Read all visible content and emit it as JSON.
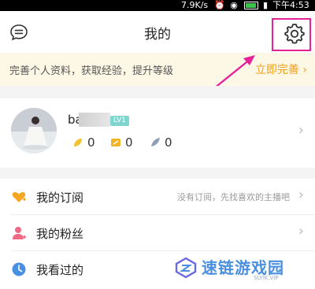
{
  "status_bar": {
    "speed": "7.9K/s",
    "time": "下午4:53"
  },
  "header": {
    "title": "我的",
    "message_icon": "message-icon",
    "settings_icon": "gear-icon"
  },
  "banner": {
    "text": "完善个人资料，获取经验，提升等级",
    "action": "立即完善",
    "action_icon": "chevron-right-icon"
  },
  "profile": {
    "username": "ba",
    "level": "LV1",
    "stats": [
      {
        "icon": "leaf-coin-icon",
        "value": "0",
        "color": "#f2c230"
      },
      {
        "icon": "ticket-icon",
        "value": "0",
        "color": "#f2b52a"
      },
      {
        "icon": "feather-icon",
        "value": "0",
        "color": "#8d9fb7"
      }
    ]
  },
  "menu": {
    "items": [
      {
        "icon": "heart-plus-icon",
        "label": "我的订阅",
        "hint": "没有订阅，先找喜欢的主播吧",
        "color": "#f5a623"
      },
      {
        "icon": "fans-icon",
        "label": "我的粉丝",
        "hint": "",
        "color": "#ef6a86"
      },
      {
        "icon": "clock-icon",
        "label": "我看过的",
        "hint": "",
        "color": "#4a90e2"
      }
    ]
  },
  "watermark": {
    "text": "速链游戏园",
    "sub": "SLYIK.VIP"
  },
  "colors": {
    "accent": "#f0a020",
    "annotation": "#e61f9b",
    "banner_bg": "#fdf8e6",
    "level_badge": "#7fd6cf"
  }
}
